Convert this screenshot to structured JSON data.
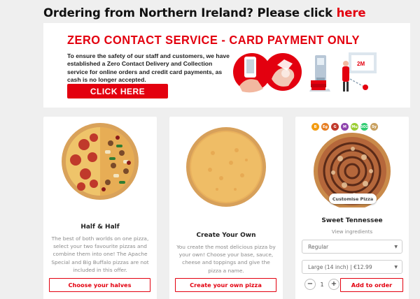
{
  "ni_banner": {
    "text": "Ordering from Northern Ireland? Please click ",
    "link": "here"
  },
  "promo": {
    "title": "ZERO CONTACT SERVICE - CARD PAYMENT ONLY",
    "body": "To ensure the safety of our staff and customers, we have established a Zero Contact Delivery and Collection service for online orders and credit card payments, as cash is no longer accepted.",
    "button": "CLICK HERE",
    "marker": "2M"
  },
  "cards": [
    {
      "title": "Half & Half",
      "description": "The best of both worlds on one pizza, select your two favourite pizzas and combine them into one! The Apache Special and Big Buffalo pizzas are not included in this offer.",
      "button": "Choose your halves"
    },
    {
      "title": "Create Your Own",
      "description": "You create the most delicious pizza by your own! Choose your base, sauce, cheese and toppings and give the pizza a name.",
      "button": "Create your own pizza"
    },
    {
      "title": "Sweet Tennessee",
      "view_ingredients": "View ingredients",
      "customise": "Customise Pizza",
      "crust_select": "Regular",
      "size_select": "Large (14 inch) | €12.99",
      "quantity": "1",
      "minus": "−",
      "plus": "+",
      "button": "Add to order",
      "allergen_tags": [
        {
          "label": "B",
          "color": "#f39c12"
        },
        {
          "label": "Eg",
          "color": "#e67e22"
        },
        {
          "label": "G",
          "color": "#c0392b"
        },
        {
          "label": "M",
          "color": "#8e44ad"
        },
        {
          "label": "Mu",
          "color": "#9acd32"
        },
        {
          "label": "SO2",
          "color": "#2ecc71"
        },
        {
          "label": "Sy",
          "color": "#c8a060"
        }
      ]
    }
  ],
  "colors": {
    "accent": "#e3000f",
    "background": "#efefef"
  }
}
